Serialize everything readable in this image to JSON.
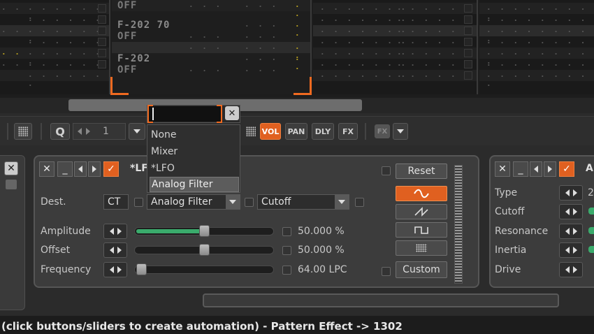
{
  "pattern": {
    "rows": [
      {
        "note": "OFF"
      },
      {
        "note": "F-202 70"
      },
      {
        "note": "OFF"
      },
      {
        "note": "F-202"
      },
      {
        "note": "OFF"
      }
    ]
  },
  "toolbar": {
    "quantize_label": "Q",
    "quantize_value": "1",
    "vol_label": "VOL",
    "pan_label": "PAN",
    "dly_label": "DLY",
    "fx_label": "FX",
    "fx_dim_label": "FX"
  },
  "popup": {
    "items": [
      "None",
      "Mixer",
      "*LFO",
      "Analog Filter"
    ],
    "selected": "Analog Filter"
  },
  "lfo_panel": {
    "title": "*LF",
    "dest_label": "Dest.",
    "dest_track": "CT",
    "dest_device": "Analog Filter",
    "dest_param": "Cutoff",
    "params": [
      {
        "label": "Amplitude",
        "value": "50.000 %",
        "level": 0.5
      },
      {
        "label": "Offset",
        "value": "50.000 %",
        "level": 0.5
      },
      {
        "label": "Frequency",
        "value": "64.00 LPC",
        "level": 0.0
      }
    ],
    "reset_label": "Reset",
    "custom_label": "Custom",
    "waveforms": [
      "sine-wave-icon",
      "saw-wave-icon",
      "square-wave-icon",
      "random-wave-icon"
    ]
  },
  "filter_panel": {
    "title": "A",
    "params": [
      "Type",
      "Cutoff",
      "Resonance",
      "Inertia",
      "Drive"
    ],
    "type_value": "2"
  },
  "status_bar": {
    "text": "(click buttons/sliders to create automation) - Pattern Effect -> 1302"
  },
  "colors": {
    "accent": "#e06020",
    "slider_fill": "#3aab6c",
    "background": "#3c3c3c"
  }
}
